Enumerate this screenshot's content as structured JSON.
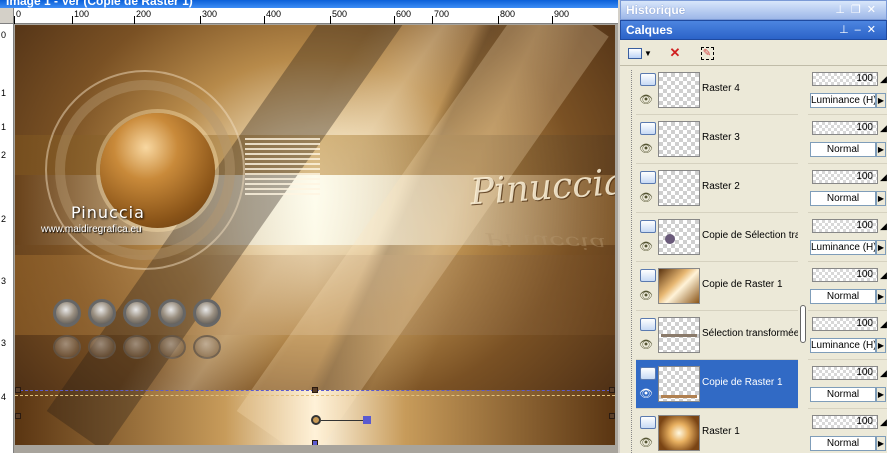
{
  "image_window": {
    "title": "Image 1 - Ver (Copie de Raster 1)",
    "ruler_h_ticks": [
      "0",
      "100",
      "200",
      "300",
      "400",
      "500",
      "600",
      "700",
      "800",
      "900"
    ],
    "ruler_v_ticks": [
      "0",
      "1",
      "1",
      "2",
      "2",
      "3",
      "3",
      "4"
    ],
    "artwork": {
      "signature": "Pinuccia",
      "website": "www.maidiregrafica.eu",
      "watermark": "Pinuccia"
    }
  },
  "history_palette": {
    "title": "Historique"
  },
  "layers_palette": {
    "title": "Calques",
    "layers": [
      {
        "name": "Raster 4",
        "opacity": "100",
        "blend": "Luminance (H)",
        "selected": false
      },
      {
        "name": "Raster 3",
        "opacity": "100",
        "blend": "Normal",
        "selected": false
      },
      {
        "name": "Raster 2",
        "opacity": "100",
        "blend": "Normal",
        "selected": false
      },
      {
        "name": "Copie de Sélection tran",
        "opacity": "100",
        "blend": "Luminance (H)",
        "selected": false
      },
      {
        "name": "Copie de Raster 1",
        "opacity": "100",
        "blend": "Normal",
        "selected": false
      },
      {
        "name": "Sélection transformée",
        "opacity": "100",
        "blend": "Luminance (H)",
        "selected": false
      },
      {
        "name": "Copie de Raster 1",
        "opacity": "100",
        "blend": "Normal",
        "selected": true
      },
      {
        "name": "Raster 1",
        "opacity": "100",
        "blend": "Normal",
        "selected": false
      }
    ]
  },
  "icons": {
    "pin": "pin-icon",
    "restore": "restore-icon",
    "close": "close-icon",
    "new_layer": "new-layer-icon",
    "delete_layer": "delete-layer-icon",
    "edit_selection": "edit-selection-icon",
    "eye": "visibility-eye-icon"
  },
  "colors": {
    "selected_row": "#316ac5",
    "palette_title_active": "#2c63c8",
    "palette_title_inactive": "#9db7e8"
  }
}
